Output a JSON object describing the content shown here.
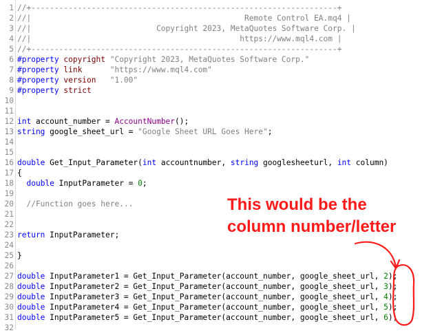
{
  "editor": {
    "lines": [
      {
        "n": "1",
        "segs": [
          {
            "t": "//+------------------------------------------------------------------+",
            "c": "c-gray"
          }
        ]
      },
      {
        "n": "2",
        "segs": [
          {
            "t": "//|                                              Remote Control EA.mq4 |",
            "c": "c-gray"
          }
        ]
      },
      {
        "n": "3",
        "segs": [
          {
            "t": "//|                           Copyright 2023, MetaQuotes Software Corp. |",
            "c": "c-gray"
          }
        ]
      },
      {
        "n": "4",
        "segs": [
          {
            "t": "//|                                             https://www.mql4.com |",
            "c": "c-gray"
          }
        ]
      },
      {
        "n": "5",
        "segs": [
          {
            "t": "//+------------------------------------------------------------------+",
            "c": "c-gray"
          }
        ]
      },
      {
        "n": "6",
        "segs": [
          {
            "t": "#property ",
            "c": "c-kw"
          },
          {
            "t": "copyright",
            "c": "c-prop"
          },
          {
            "t": " \"Copyright 2023, MetaQuotes Software Corp.\"",
            "c": "c-str"
          }
        ]
      },
      {
        "n": "7",
        "segs": [
          {
            "t": "#property ",
            "c": "c-kw"
          },
          {
            "t": "link",
            "c": "c-prop"
          },
          {
            "t": "      \"https://www.mql4.com\"",
            "c": "c-str"
          }
        ]
      },
      {
        "n": "8",
        "segs": [
          {
            "t": "#property ",
            "c": "c-kw"
          },
          {
            "t": "version",
            "c": "c-prop"
          },
          {
            "t": "   \"1.00\"",
            "c": "c-str"
          }
        ]
      },
      {
        "n": "9",
        "segs": [
          {
            "t": "#property ",
            "c": "c-kw"
          },
          {
            "t": "strict",
            "c": "c-prop"
          }
        ]
      },
      {
        "n": "10",
        "segs": []
      },
      {
        "n": "11",
        "segs": []
      },
      {
        "n": "12",
        "segs": [
          {
            "t": "int",
            "c": "c-kw"
          },
          {
            "t": " account_number = ",
            "c": ""
          },
          {
            "t": "AccountNumber",
            "c": "c-purple"
          },
          {
            "t": "();",
            "c": ""
          }
        ]
      },
      {
        "n": "13",
        "segs": [
          {
            "t": "string",
            "c": "c-kw"
          },
          {
            "t": " google_sheet_url = ",
            "c": ""
          },
          {
            "t": "\"Google Sheet URL Goes Here\"",
            "c": "c-str"
          },
          {
            "t": ";",
            "c": ""
          }
        ]
      },
      {
        "n": "14",
        "segs": []
      },
      {
        "n": "15",
        "segs": []
      },
      {
        "n": "16",
        "segs": [
          {
            "t": "double",
            "c": "c-kw"
          },
          {
            "t": " Get_Input_Parameter(",
            "c": ""
          },
          {
            "t": "int",
            "c": "c-kw"
          },
          {
            "t": " accountnumber, ",
            "c": ""
          },
          {
            "t": "string",
            "c": "c-kw"
          },
          {
            "t": " googlesheeturl, ",
            "c": ""
          },
          {
            "t": "int",
            "c": "c-kw"
          },
          {
            "t": " column)",
            "c": ""
          }
        ]
      },
      {
        "n": "17",
        "segs": [
          {
            "t": "{",
            "c": ""
          }
        ]
      },
      {
        "n": "18",
        "segs": [
          {
            "t": "  ",
            "c": ""
          },
          {
            "t": "double",
            "c": "c-kw"
          },
          {
            "t": " InputParameter = ",
            "c": ""
          },
          {
            "t": "0",
            "c": "c-green"
          },
          {
            "t": ";",
            "c": ""
          }
        ]
      },
      {
        "n": "19",
        "segs": []
      },
      {
        "n": "20",
        "segs": [
          {
            "t": "  //Function goes here...",
            "c": "c-gray"
          }
        ]
      },
      {
        "n": "21",
        "segs": []
      },
      {
        "n": "22",
        "segs": []
      },
      {
        "n": "23",
        "segs": [
          {
            "t": "return",
            "c": "c-kw"
          },
          {
            "t": " InputParameter;",
            "c": ""
          }
        ]
      },
      {
        "n": "24",
        "segs": []
      },
      {
        "n": "25",
        "segs": [
          {
            "t": "}",
            "c": ""
          }
        ]
      },
      {
        "n": "26",
        "segs": []
      },
      {
        "n": "27",
        "segs": [
          {
            "t": "double",
            "c": "c-kw"
          },
          {
            "t": " InputParameter1 = Get_Input_Parameter(account_number, google_sheet_url, ",
            "c": ""
          },
          {
            "t": "2",
            "c": "c-green"
          },
          {
            "t": ");",
            "c": ""
          }
        ]
      },
      {
        "n": "28",
        "segs": [
          {
            "t": "double",
            "c": "c-kw"
          },
          {
            "t": " InputParameter2 = Get_Input_Parameter(account_number, google_sheet_url, ",
            "c": ""
          },
          {
            "t": "3",
            "c": "c-green"
          },
          {
            "t": ");",
            "c": ""
          }
        ]
      },
      {
        "n": "29",
        "segs": [
          {
            "t": "double",
            "c": "c-kw"
          },
          {
            "t": " InputParameter3 = Get_Input_Parameter(account_number, google_sheet_url, ",
            "c": ""
          },
          {
            "t": "4",
            "c": "c-green"
          },
          {
            "t": ");",
            "c": ""
          }
        ]
      },
      {
        "n": "30",
        "segs": [
          {
            "t": "double",
            "c": "c-kw"
          },
          {
            "t": " InputParameter4 = Get_Input_Parameter(account_number, google_sheet_url, ",
            "c": ""
          },
          {
            "t": "5",
            "c": "c-green"
          },
          {
            "t": ");",
            "c": ""
          }
        ]
      },
      {
        "n": "31",
        "segs": [
          {
            "t": "double",
            "c": "c-kw"
          },
          {
            "t": " InputParameter5 = Get_Input_Parameter(account_number, google_sheet_url, ",
            "c": ""
          },
          {
            "t": "6",
            "c": "c-green"
          },
          {
            "t": ");",
            "c": ""
          }
        ]
      },
      {
        "n": "32",
        "segs": []
      }
    ]
  },
  "annotation": {
    "line1": "This would be the",
    "line2": "column number/letter",
    "color": "#ff1a1a"
  }
}
